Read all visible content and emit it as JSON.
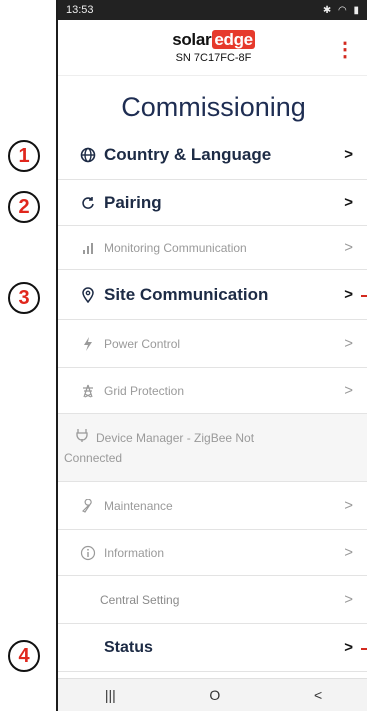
{
  "statusbar": {
    "time": "13:53",
    "icons": "✱ ◠ ▮"
  },
  "app": {
    "logo_part1": "solar",
    "logo_part2": "edge",
    "serial": "SN 7C17FC-8F",
    "menu_icon": "kebab-menu-icon"
  },
  "page": {
    "title": "Commissioning"
  },
  "callouts": [
    "1",
    "2",
    "3",
    "4"
  ],
  "menu": {
    "country": "Country & Language",
    "pairing": "Pairing",
    "monitoring": "Monitoring Communication",
    "site": "Site Communication",
    "power": "Power Control",
    "grid": "Grid Protection",
    "device_line1": "Device Manager - ZigBee Not",
    "device_line2": "Connected",
    "maintenance": "Maintenance",
    "information": "Information",
    "central": "Central Setting",
    "status": "Status",
    "chevron": ">"
  },
  "navbar": {
    "recent": "|||",
    "home": "O",
    "back": "<"
  },
  "colors": {
    "accent": "#e63a2c",
    "text": "#1d2b45",
    "muted": "#9a9a9a"
  }
}
